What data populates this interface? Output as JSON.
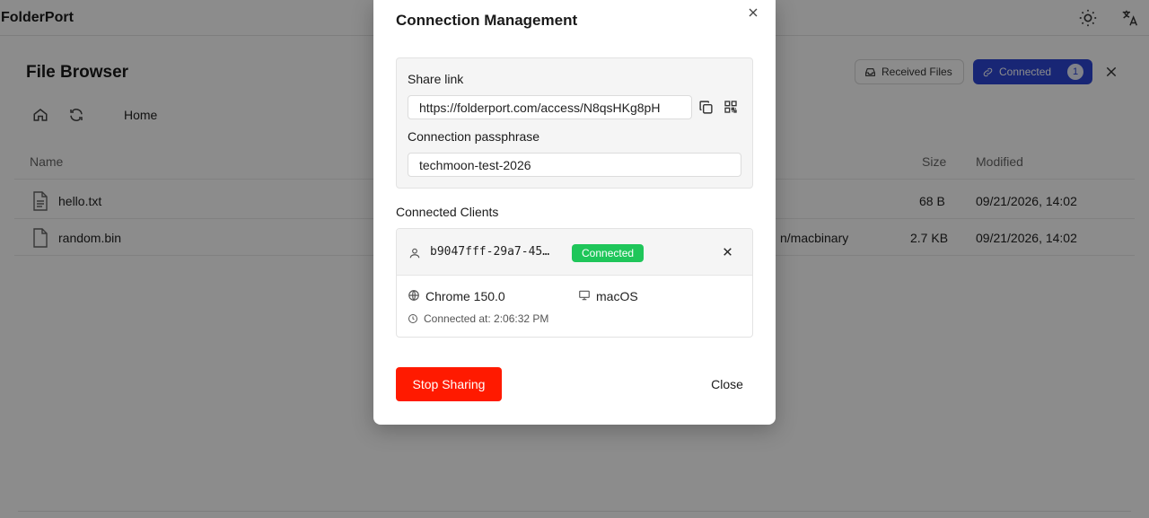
{
  "app": {
    "brand": "FolderPort",
    "panel_title": "File Browser",
    "breadcrumb_home": "Home",
    "received_files_label": "Received Files",
    "connected_label": "Connected",
    "connected_count": "1",
    "table": {
      "columns": [
        "Name",
        "Size",
        "Modified"
      ],
      "rows": [
        {
          "name": "hello.txt",
          "type": "",
          "size": "68 B",
          "modified": "09/21/2026, 14:02"
        },
        {
          "name": "random.bin",
          "type": "n/macbinary",
          "size": "2.7 KB",
          "modified": "09/21/2026, 14:02"
        }
      ]
    }
  },
  "modal": {
    "title": "Connection Management",
    "share_link_label": "Share link",
    "share_link_value": "https://folderport.com/access/N8qsHKg8pH",
    "passphrase_label": "Connection passphrase",
    "passphrase_value": "techmoon-test-2026",
    "connected_clients_label": "Connected Clients",
    "client": {
      "id": "b9047fff-29a7-45…",
      "status": "Connected",
      "browser": "Chrome 150.0",
      "os": "macOS",
      "connected_at": "Connected at: 2:06:32 PM"
    },
    "stop_label": "Stop Sharing",
    "close_label": "Close"
  },
  "colors": {
    "accent": "#2c46d6",
    "danger": "#ff1a00",
    "success": "#1fc65a"
  }
}
